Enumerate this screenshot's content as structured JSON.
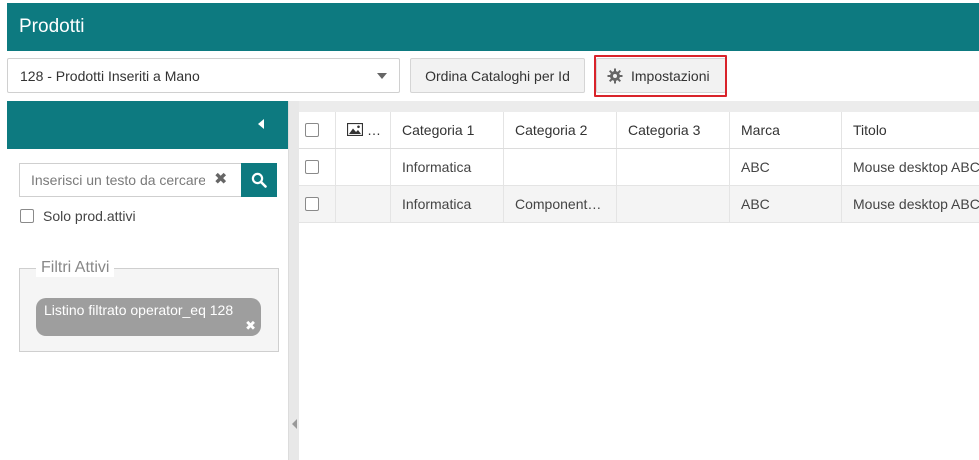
{
  "header": {
    "title": "Prodotti"
  },
  "toolbar": {
    "catalog_value": "128 - Prodotti Inseriti a Mano",
    "order_label": "Ordina Cataloghi per Id",
    "settings_label": "Impostazioni",
    "settings_icon": "gear-icon"
  },
  "sidebar": {
    "search_placeholder": "Inserisci un testo da cercare",
    "search_icon": "search-icon",
    "clear_icon": "close-icon",
    "active_label": "Solo prod.attivi",
    "filters_legend": "Filtri Attivi",
    "filter_chip": "Listino filtrato operator_eq 128",
    "chip_close": "✖"
  },
  "grid": {
    "columns": [
      "",
      "…",
      "Categoria 1",
      "Categoria 2",
      "Categoria 3",
      "Marca",
      "Titolo"
    ],
    "image_column_icon": "image-icon",
    "rows": [
      {
        "cat1": "Informatica",
        "cat2": "",
        "cat3": "",
        "marca": "ABC",
        "titolo": "Mouse desktop ABC"
      },
      {
        "cat1": "Informatica",
        "cat2": "Component…",
        "cat3": "",
        "marca": "ABC",
        "titolo": "Mouse desktop ABC"
      }
    ]
  },
  "colors": {
    "accent": "#0d7a80",
    "highlight": "#d9232a",
    "chip": "#9e9e9e"
  }
}
